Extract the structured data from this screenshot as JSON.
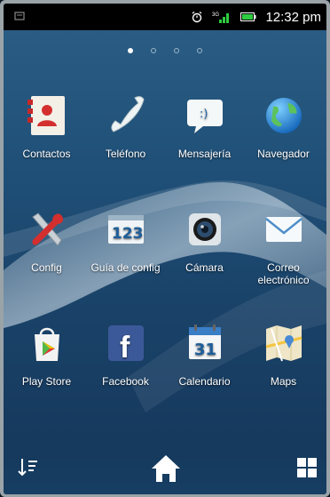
{
  "status_bar": {
    "time": "12:32 pm"
  },
  "page_indicator": {
    "count": 4,
    "active": 0
  },
  "apps": [
    {
      "label": "Contactos",
      "icon": "contacts-icon"
    },
    {
      "label": "Teléfono",
      "icon": "phone-icon"
    },
    {
      "label": "Mensajería",
      "icon": "messaging-icon"
    },
    {
      "label": "Navegador",
      "icon": "browser-icon"
    },
    {
      "label": "Config",
      "icon": "settings-icon"
    },
    {
      "label": "Guía de config",
      "icon": "setup-guide-icon"
    },
    {
      "label": "Cámara",
      "icon": "camera-icon"
    },
    {
      "label": "Correo electrónico",
      "icon": "email-icon"
    },
    {
      "label": "Play Store",
      "icon": "play-store-icon"
    },
    {
      "label": "Facebook",
      "icon": "facebook-icon"
    },
    {
      "label": "Calendario",
      "icon": "calendar-icon"
    },
    {
      "label": "Maps",
      "icon": "maps-icon"
    }
  ],
  "setup_guide_badge": "123",
  "calendar_day": "31",
  "facebook_letter": "f",
  "colors": {
    "status_bar": "#000000",
    "wallpaper_top": "#2c5f86",
    "wallpaper_bottom": "#15365a"
  }
}
